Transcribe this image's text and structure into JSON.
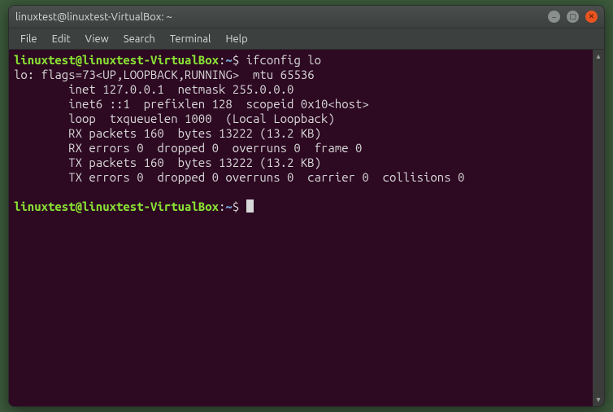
{
  "window": {
    "title": "linuxtest@linuxtest-VirtualBox: ~"
  },
  "winControls": {
    "minimize": "–",
    "maximize": "▢",
    "close": "✕"
  },
  "menubar": [
    "File",
    "Edit",
    "View",
    "Search",
    "Terminal",
    "Help"
  ],
  "prompt": {
    "userhost": "linuxtest@linuxtest-VirtualBox",
    "sep": ":",
    "path": "~",
    "sigil": "$"
  },
  "command1": "ifconfig lo",
  "output": [
    "lo: flags=73<UP,LOOPBACK,RUNNING>  mtu 65536",
    "        inet 127.0.0.1  netmask 255.0.0.0",
    "        inet6 ::1  prefixlen 128  scopeid 0x10<host>",
    "        loop  txqueuelen 1000  (Local Loopback)",
    "        RX packets 160  bytes 13222 (13.2 KB)",
    "        RX errors 0  dropped 0  overruns 0  frame 0",
    "        TX packets 160  bytes 13222 (13.2 KB)",
    "        TX errors 0  dropped 0 overruns 0  carrier 0  collisions 0",
    ""
  ],
  "icons": {
    "scrollUp": "▴",
    "scrollDown": "▾"
  }
}
